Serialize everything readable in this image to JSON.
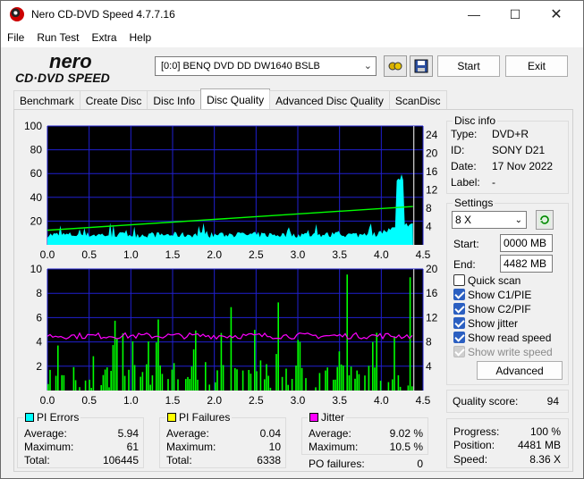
{
  "window": {
    "title": "Nero CD-DVD Speed 4.7.7.16"
  },
  "menu": [
    "File",
    "Run Test",
    "Extra",
    "Help"
  ],
  "logo": {
    "line1": "nero",
    "line2": "CD·DVD SPEED"
  },
  "toolbar": {
    "drive": "[0:0]   BENQ DVD DD DW1640 BSLB",
    "start": "Start",
    "exit": "Exit"
  },
  "tabs": [
    "Benchmark",
    "Create Disc",
    "Disc Info",
    "Disc Quality",
    "Advanced Disc Quality",
    "ScanDisc"
  ],
  "disc_info": {
    "caption": "Disc info",
    "type_label": "Type:",
    "type": "DVD+R",
    "id_label": "ID:",
    "id": "SONY D21",
    "date_label": "Date:",
    "date": "17 Nov 2022",
    "label_label": "Label:",
    "label": "-"
  },
  "settings": {
    "caption": "Settings",
    "speed": "8 X",
    "start_label": "Start:",
    "start": "0000 MB",
    "end_label": "End:",
    "end": "4482 MB",
    "checks": [
      {
        "label": "Quick scan",
        "checked": false
      },
      {
        "label": "Show C1/PIE",
        "checked": true
      },
      {
        "label": "Show C2/PIF",
        "checked": true
      },
      {
        "label": "Show jitter",
        "checked": true
      },
      {
        "label": "Show read speed",
        "checked": true
      },
      {
        "label": "Show write speed",
        "checked": true,
        "disabled": true
      }
    ],
    "advanced": "Advanced"
  },
  "quality": {
    "label": "Quality score:",
    "value": "94"
  },
  "progress": {
    "progress_label": "Progress:",
    "progress": "100 %",
    "position_label": "Position:",
    "position": "4481 MB",
    "speed_label": "Speed:",
    "speed": "8.36 X"
  },
  "pi_errors": {
    "caption": "PI Errors",
    "color": "#00ffff",
    "avg_label": "Average:",
    "avg": "5.94",
    "max_label": "Maximum:",
    "max": "61",
    "total_label": "Total:",
    "total": "106445"
  },
  "pi_failures": {
    "caption": "PI Failures",
    "color": "#ffff00",
    "avg_label": "Average:",
    "avg": "0.04",
    "max_label": "Maximum:",
    "max": "10",
    "total_label": "Total:",
    "total": "6338"
  },
  "jitter": {
    "caption": "Jitter",
    "color": "#ff00ff",
    "avg_label": "Average:",
    "avg": "9.02 %",
    "max_label": "Maximum:",
    "max": "10.5 %",
    "po_label": "PO failures:",
    "po": "0"
  },
  "chart_data": [
    {
      "type": "area",
      "series": [
        {
          "name": "PI Errors",
          "color": "#00ffff"
        },
        {
          "name": "Read speed",
          "color": "#00ff00"
        }
      ],
      "xlim": [
        0,
        4.5
      ],
      "xticks": [
        "0.0",
        "0.5",
        "1.0",
        "1.5",
        "2.0",
        "2.5",
        "3.0",
        "3.5",
        "4.0",
        "4.5"
      ],
      "ylim_left": [
        0,
        100
      ],
      "yticks_left": [
        "20",
        "40",
        "60",
        "80",
        "100"
      ],
      "ylim_right": [
        0,
        26
      ],
      "yticks_right": [
        "4",
        "8",
        "12",
        "16",
        "20",
        "24"
      ],
      "pie_baseline": 6,
      "pie_peak": {
        "x": 4.23,
        "y": 61
      },
      "read_speed": {
        "x": [
          0,
          4.38
        ],
        "y": [
          3.2,
          8.4
        ]
      }
    },
    {
      "type": "bar",
      "series": [
        {
          "name": "PI Failures",
          "color": "#00ff00"
        },
        {
          "name": "Jitter",
          "color": "#ff00ff"
        }
      ],
      "xlim": [
        0,
        4.5
      ],
      "xticks": [
        "0.0",
        "0.5",
        "1.0",
        "1.5",
        "2.0",
        "2.5",
        "3.0",
        "3.5",
        "4.0",
        "4.5"
      ],
      "ylim_left": [
        0,
        10
      ],
      "yticks_left": [
        "2",
        "4",
        "6",
        "8",
        "10"
      ],
      "ylim_right": [
        0,
        20
      ],
      "yticks_right": [
        "4",
        "8",
        "12",
        "16",
        "20"
      ],
      "jitter_level": 9.0
    }
  ]
}
